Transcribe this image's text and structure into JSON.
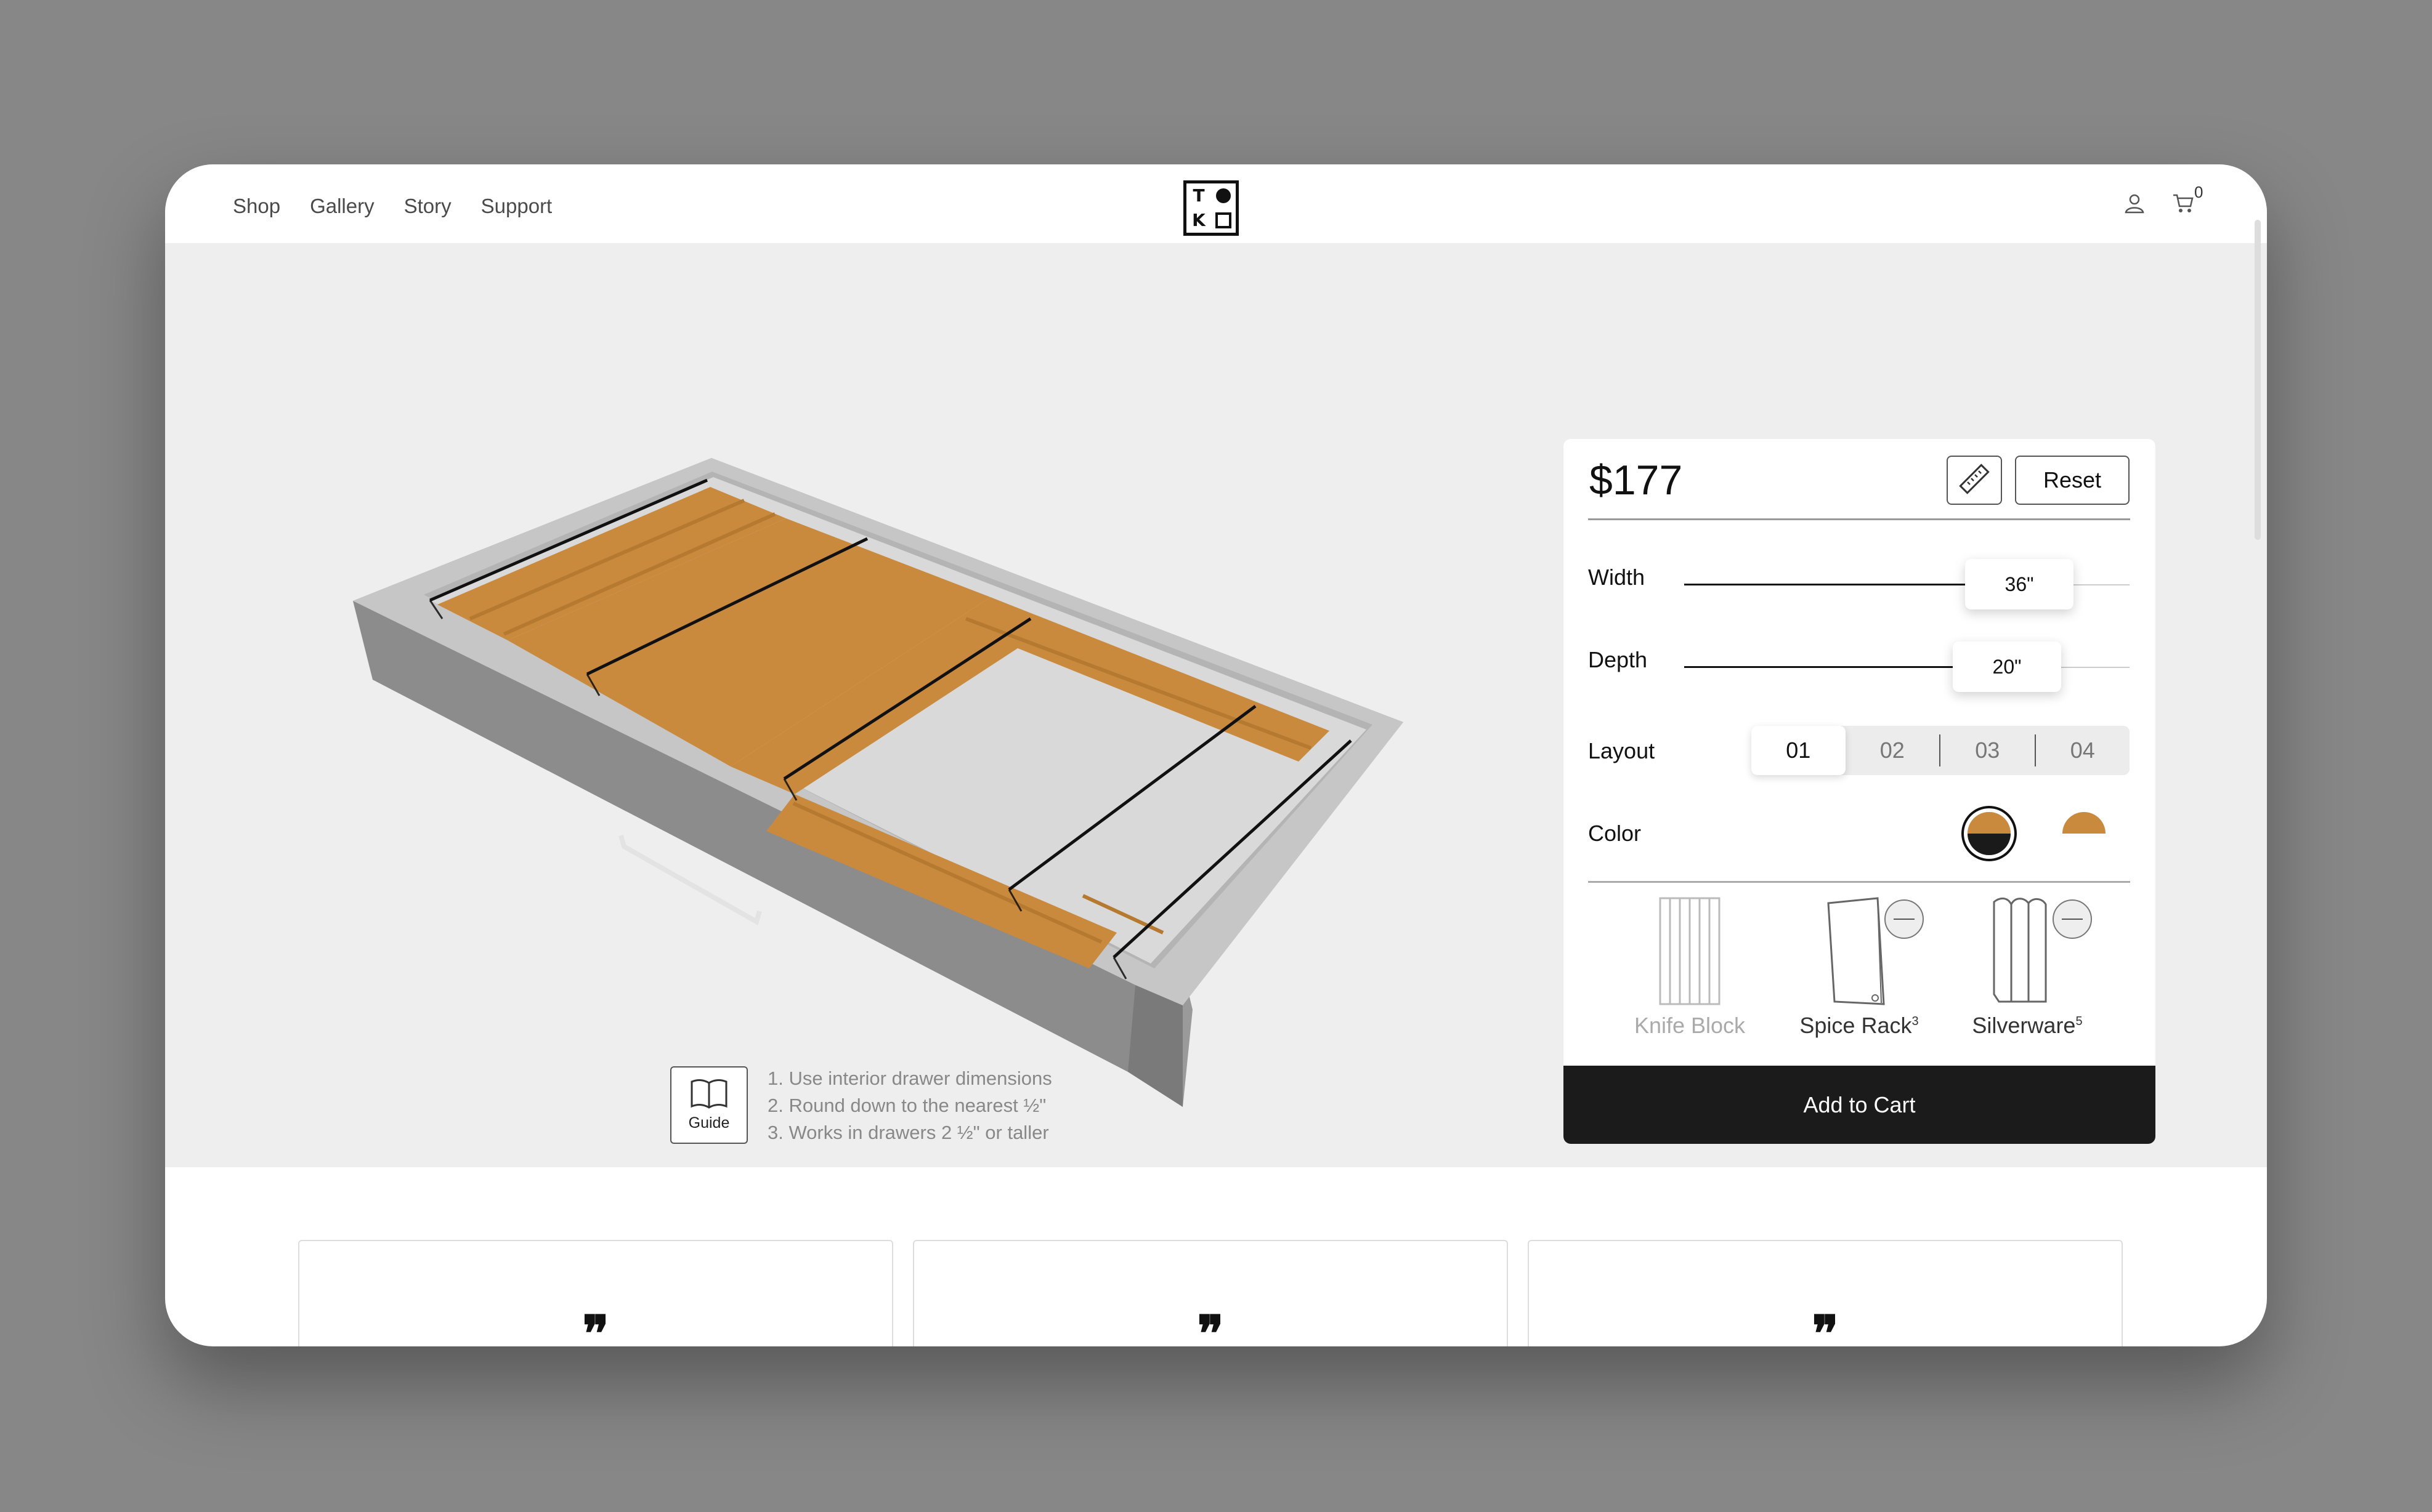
{
  "nav": {
    "items": [
      "Shop",
      "Gallery",
      "Story",
      "Support"
    ]
  },
  "logo": {
    "letters": [
      "T",
      "K"
    ]
  },
  "header": {
    "cart_count": "0"
  },
  "guide": {
    "label": "Guide",
    "steps": [
      "1. Use interior drawer dimensions",
      "2. Round down to the nearest ½\"",
      "3. Works in drawers 2 ½\" or taller"
    ]
  },
  "panel": {
    "price": "$177",
    "reset_label": "Reset",
    "width_label": "Width",
    "width_value": "36\"",
    "depth_label": "Depth",
    "depth_value": "20\"",
    "layout_label": "Layout",
    "layout_options": [
      "01",
      "02",
      "03",
      "04"
    ],
    "layout_selected": "01",
    "color_label": "Color",
    "colors": [
      {
        "name": "wood-black",
        "top": "#c98a3e",
        "bottom": "#1a1a1a",
        "selected": true
      },
      {
        "name": "wood-white",
        "top": "#c98a3e",
        "bottom": "#ffffff",
        "selected": false
      }
    ],
    "accessories": [
      {
        "name": "Knife Block",
        "count": "",
        "active": false
      },
      {
        "name": "Spice Rack",
        "count": "3",
        "active": true
      },
      {
        "name": "Silverware",
        "count": "5",
        "active": true
      }
    ],
    "add_to_cart": "Add to Cart"
  },
  "reviews": {
    "quote_glyph": "❞"
  },
  "colors": {
    "background": "#878787",
    "stage": "#eeeeee",
    "wood": "#c98a3e",
    "cart_button": "#1b1b1b"
  }
}
